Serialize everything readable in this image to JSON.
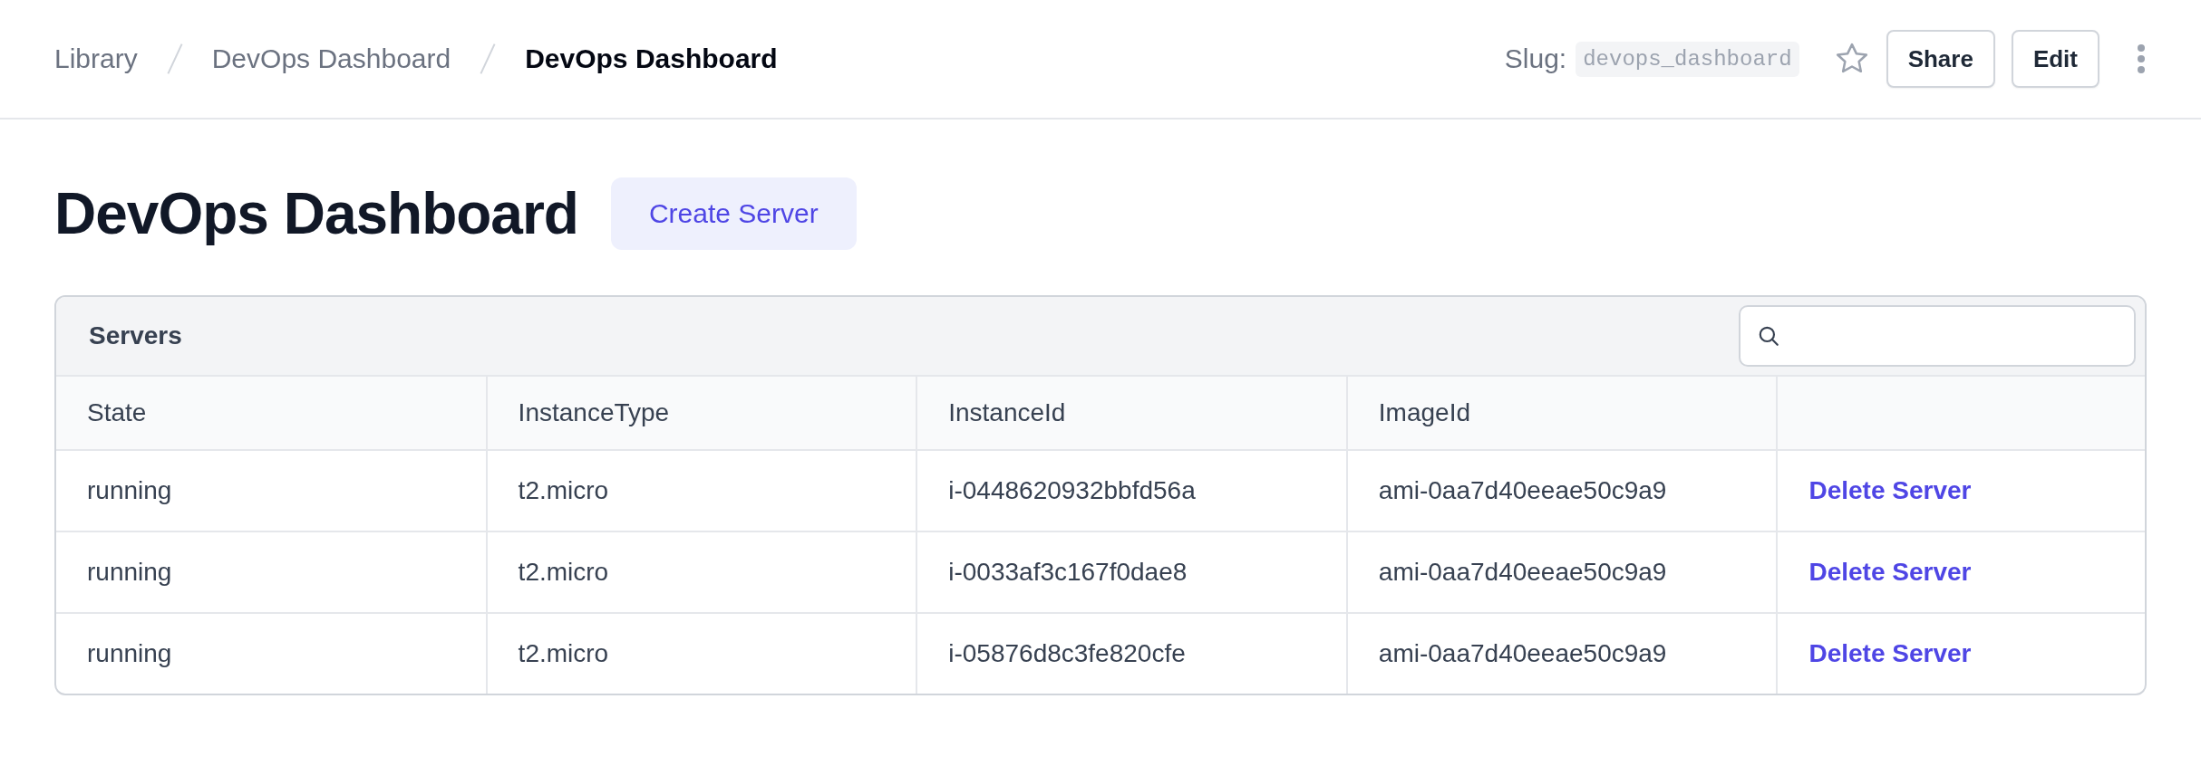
{
  "breadcrumbs": [
    {
      "label": "Library",
      "current": false
    },
    {
      "label": "DevOps Dashboard",
      "current": false
    },
    {
      "label": "DevOps Dashboard",
      "current": true
    }
  ],
  "slug": {
    "label": "Slug:",
    "value": "devops_dashboard"
  },
  "favorite": {
    "on": false
  },
  "header_buttons": [
    "Share",
    "Edit"
  ],
  "page_title": "DevOps Dashboard",
  "primary_button": "Create Server",
  "table": {
    "title": "Servers",
    "columns": [
      "State",
      "InstanceType",
      "InstanceId",
      "ImageId"
    ],
    "rows": [
      {
        "cells": [
          "running",
          "t2.micro",
          "i-0448620932bbfd56a",
          "ami-0aa7d40eeae50c9a9"
        ],
        "action": "Delete Server"
      },
      {
        "cells": [
          "running",
          "t2.micro",
          "i-0033af3c167f0dae8",
          "ami-0aa7d40eeae50c9a9"
        ],
        "action": "Delete Server"
      },
      {
        "cells": [
          "running",
          "t2.micro",
          "i-05876d8c3fe820cfe",
          "ami-0aa7d40eeae50c9a9"
        ],
        "action": "Delete Server"
      }
    ]
  }
}
